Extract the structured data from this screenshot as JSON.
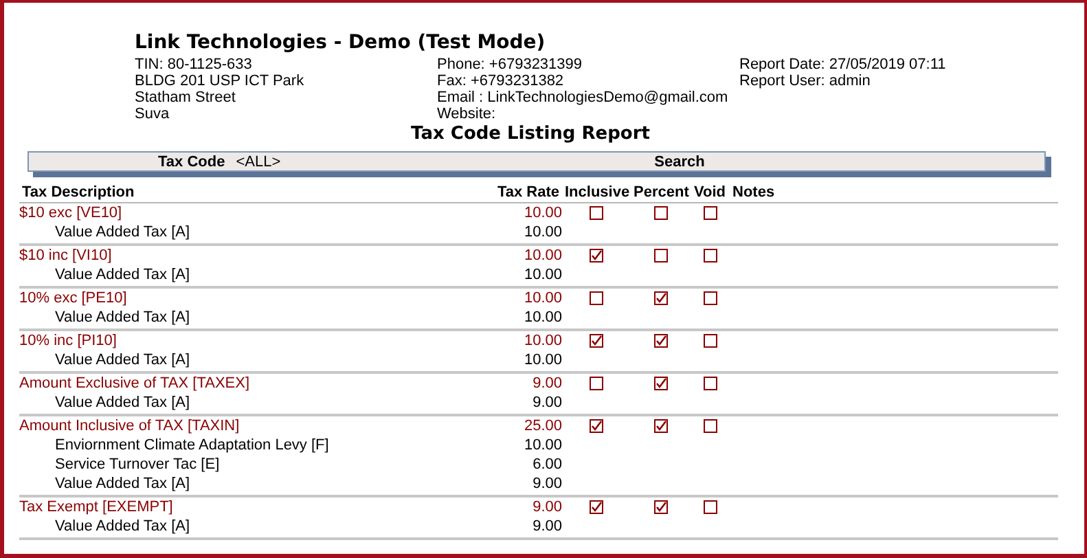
{
  "company": {
    "name": "Link Technologies - Demo (Test Mode)",
    "column_1": [
      "TIN: 80-1125-633",
      "BLDG 201 USP ICT Park",
      "Statham Street",
      "Suva"
    ],
    "column_2": [
      "Phone: +6793231399",
      "Fax: +6793231382",
      "Email : LinkTechnologiesDemo@gmail.com",
      "Website:"
    ],
    "column_3": [
      "Report Date: 27/05/2019 07:11",
      "Report User: admin"
    ]
  },
  "report_title": "Tax Code Listing Report",
  "filter_bar": {
    "label": "Tax Code",
    "value": "<ALL>",
    "button": "Search"
  },
  "columns": [
    "Tax Description",
    "Tax Rate",
    "Inclusive",
    "Percent",
    "Void",
    "Notes"
  ],
  "rows": [
    {
      "description": "$10 exc [VE10]",
      "rate": "10.00",
      "inclusive": false,
      "percent": false,
      "void": false,
      "components": [
        {
          "description": "Value Added Tax [A]",
          "rate": "10.00"
        }
      ]
    },
    {
      "description": "$10 inc [VI10]",
      "rate": "10.00",
      "inclusive": true,
      "percent": false,
      "void": false,
      "components": [
        {
          "description": "Value Added Tax [A]",
          "rate": "10.00"
        }
      ]
    },
    {
      "description": "10% exc [PE10]",
      "rate": "10.00",
      "inclusive": false,
      "percent": true,
      "void": false,
      "components": [
        {
          "description": "Value Added Tax [A]",
          "rate": "10.00"
        }
      ]
    },
    {
      "description": "10% inc [PI10]",
      "rate": "10.00",
      "inclusive": true,
      "percent": true,
      "void": false,
      "components": [
        {
          "description": "Value Added Tax [A]",
          "rate": "10.00"
        }
      ]
    },
    {
      "description": "Amount Exclusive of TAX [TAXEX]",
      "rate": "9.00",
      "inclusive": false,
      "percent": true,
      "void": false,
      "components": [
        {
          "description": "Value Added Tax [A]",
          "rate": "9.00"
        }
      ]
    },
    {
      "description": "Amount Inclusive of TAX [TAXIN]",
      "rate": "25.00",
      "inclusive": true,
      "percent": true,
      "void": false,
      "components": [
        {
          "description": "Enviornment Climate Adaptation Levy [F]",
          "rate": "10.00"
        },
        {
          "description": "Service Turnover Tac [E]",
          "rate": "6.00"
        },
        {
          "description": "Value Added Tax [A]",
          "rate": "9.00"
        }
      ]
    },
    {
      "description": "Tax Exempt [EXEMPT]",
      "rate": "9.00",
      "inclusive": true,
      "percent": true,
      "void": false,
      "components": [
        {
          "description": "Value Added Tax [A]",
          "rate": "9.00"
        }
      ]
    }
  ]
}
